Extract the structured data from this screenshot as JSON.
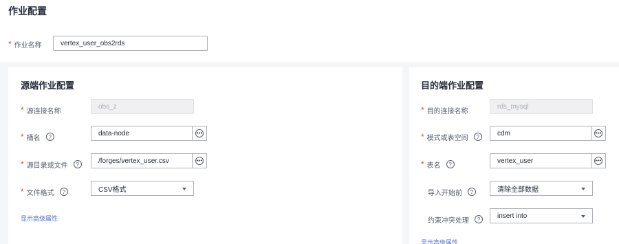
{
  "page": {
    "title": "作业配置",
    "job_name_label": "作业名称",
    "job_name_value": "vertex_user_obs2rds",
    "required_mark": "*"
  },
  "source": {
    "title": "源端作业配置",
    "connection_label": "源连接名称",
    "connection_value": "obs_z",
    "bucket_label": "桶名",
    "bucket_value": "data-node",
    "dir_label": "源目录或文件",
    "dir_value": "/forges/vertex_user.csv",
    "format_label": "文件格式",
    "format_value": "CSV格式",
    "advanced_link": "显示高级属性"
  },
  "dest": {
    "title": "目的端作业配置",
    "connection_label": "目的连接名称",
    "connection_value": "rds_mysql",
    "schema_label": "模式或表空间",
    "schema_value": "cdm",
    "table_label": "表名",
    "table_value": "vertex_user",
    "before_import_label": "导入开始前",
    "before_import_value": "清除全部数据",
    "conflict_label": "约束冲突处理",
    "conflict_value": "insert into",
    "advanced_link": "显示高级属性"
  },
  "icons": {
    "help": "?",
    "more": "•••"
  },
  "colors": {
    "required": "#e54545",
    "link": "#526ecc",
    "background": "#f5f6f8"
  }
}
